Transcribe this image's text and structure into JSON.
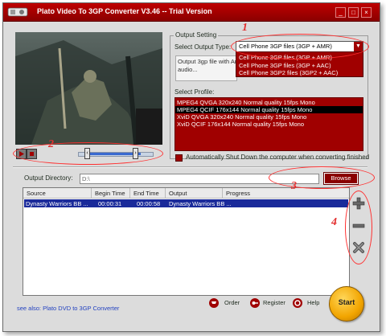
{
  "window": {
    "title": "Plato Video To 3GP Converter V3.46 -- Trial Version"
  },
  "titlebar_buttons": [
    "minimize-icon",
    "maximize-icon",
    "close-icon"
  ],
  "output_setting": {
    "group_label": "Output Setting",
    "select_type_label": "Select Output Type:",
    "selected_type": "Cell Phone 3GP files (3GP + AMR)",
    "type_options": [
      "Cell Phone 3GP files (3GP + AMR)",
      "Cell Phone 3GP files (3GP + AAC)",
      "Cell Phone 3GP2 files (3GP2 + AAC)"
    ],
    "description": "Output 3gp file with Am... phones. But the audio...",
    "select_profile_label": "Select Profile:",
    "profiles": [
      "MPEG4 QVGA 320x240 Normal quality 15fps Mono",
      "MPEG4 QCIF 176x144 Normal quality 15fps Mono",
      "XviD QVGA 320x240 Normal quality 15fps Mono",
      "XviD QCIF 176x144 Normal quality 15fps Mono"
    ],
    "shutdown_label": "Automatically Shut Down the computer when converting finished"
  },
  "output_directory": {
    "label": "Output Directory:",
    "value": "D:\\",
    "browse_label": "Browse"
  },
  "file_table": {
    "columns": [
      "Source",
      "Begin Time",
      "End Time",
      "Output",
      "Progress"
    ],
    "rows": [
      {
        "source": "Dynasty Warriors BB ...",
        "begin": "00:00:31",
        "end": "00:00:58",
        "output": "Dynasty Warriors BB ...",
        "progress": ""
      }
    ]
  },
  "annotations": [
    "1",
    "2",
    "3",
    "4"
  ],
  "footer": {
    "see_also": "see also: Plato DVD to 3GP Converter",
    "order_label": "Order",
    "register_label": "Register",
    "help_label": "Help",
    "start_label": "Start"
  },
  "colors": {
    "accent": "#a00000",
    "selection": "#1a2a9a",
    "start": "#f2a500",
    "annotation": "#ff3030"
  }
}
